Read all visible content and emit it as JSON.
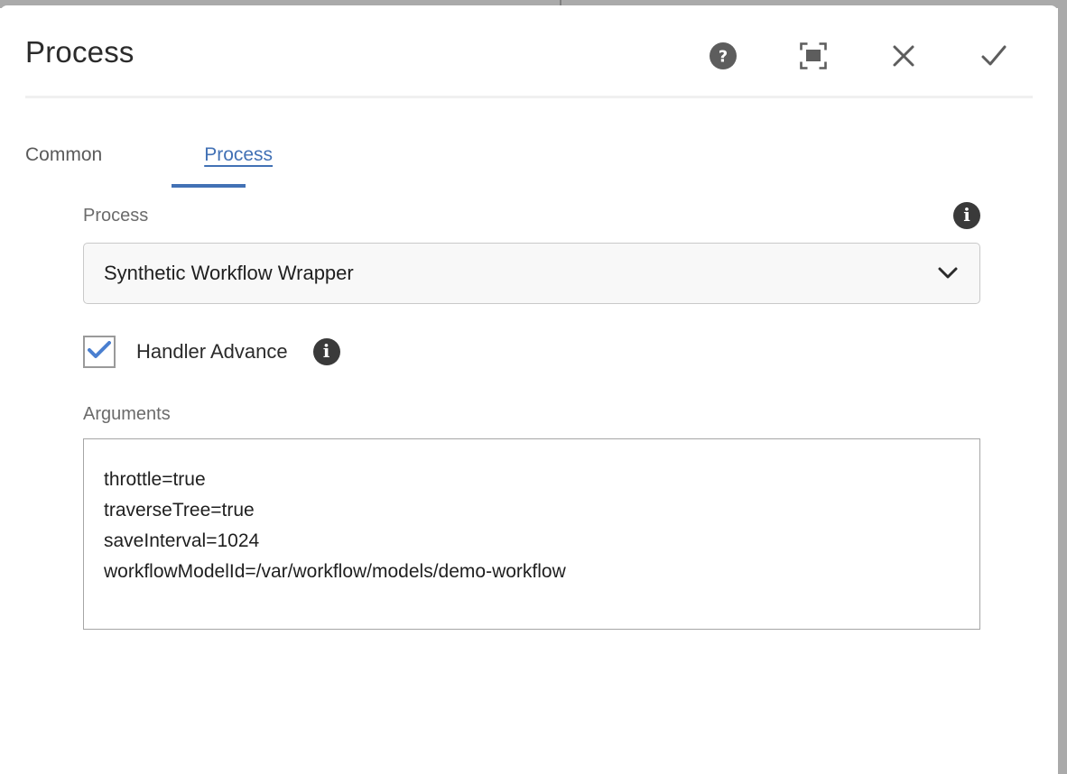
{
  "window": {
    "accent_color": "#4271b5",
    "info_icon_color": "#3a3a3a",
    "panel_background": "#ffffff",
    "chrome_color": "#aaaaaa"
  },
  "header": {
    "title": "Process",
    "actions": [
      {
        "name": "help-icon",
        "label": "Help",
        "glyph": "?"
      },
      {
        "name": "fullscreen-icon",
        "label": "Fullscreen",
        "glyph": "fullscreen"
      },
      {
        "name": "close-icon",
        "label": "Close",
        "glyph": "×"
      },
      {
        "name": "confirm-icon",
        "label": "Done",
        "glyph": "✓"
      }
    ]
  },
  "tabs": [
    {
      "label": "Common",
      "active": false
    },
    {
      "label": "Process",
      "active": true
    }
  ],
  "form": {
    "process": {
      "label": "Process",
      "info_label": "i",
      "selected": "Synthetic Workflow Wrapper",
      "chevron": "chevron-down"
    },
    "handler_advance": {
      "label": "Handler Advance",
      "checked": true,
      "info_label": "i"
    },
    "arguments": {
      "label": "Arguments",
      "value": "throttle=true\ntraverseTree=true\nsaveInterval=1024\nworkflowModelId=/var/workflow/models/demo-workflow",
      "placeholder": ""
    }
  }
}
